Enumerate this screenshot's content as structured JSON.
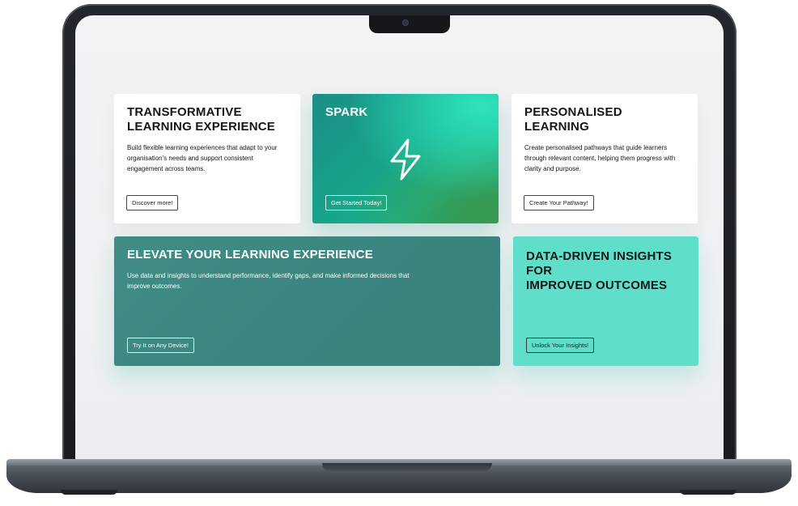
{
  "cards": {
    "transformative": {
      "title": "TRANSFORMATIVE\nLEARNING EXPERIENCE",
      "text": "Build flexible learning experiences that adapt to your organisation's needs and support consistent engagement across teams.",
      "button": "Discover more!"
    },
    "spark": {
      "title": "SPARK",
      "icon": "lightning-bolt-icon",
      "button": "Get Started Today!"
    },
    "personalised": {
      "title": "PERSONALISED\nLEARNING",
      "text": "Create personalised pathways that guide learners through relevant content, helping them progress with clarity and purpose.",
      "button": "Create Your Pathway!"
    },
    "elevate": {
      "title": "ELEVATE YOUR LEARNING EXPERIENCE",
      "text": "Use data and insights to understand performance, identify gaps, and make informed decisions that improve outcomes.",
      "button": "Try It on Any Device!"
    },
    "insights": {
      "title": "DATA-DRIVEN INSIGHTS\nFOR\nIMPROVED OUTCOMES",
      "button": "Unlock Your Insights!"
    }
  },
  "colors": {
    "screen_bg": "#eff1f3",
    "spark_gradient": [
      "#1b8e86",
      "#2de3bd",
      "#2a8e55"
    ],
    "elevate_bg": "#3f8d86",
    "insights_bg": "#5fdec9",
    "white_card": "#ffffff"
  }
}
